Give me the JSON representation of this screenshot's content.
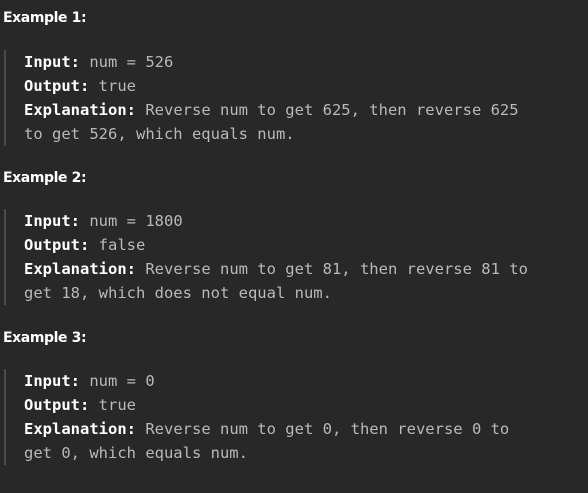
{
  "examples": [
    {
      "heading": "Example 1:",
      "input_label": "Input:",
      "input_value": "num = 526",
      "output_label": "Output:",
      "output_value": "true",
      "explanation_label": "Explanation:",
      "explanation_line1": "Reverse num to get 625, then reverse 625",
      "explanation_line2": "to get 526, which equals num."
    },
    {
      "heading": "Example 2:",
      "input_label": "Input:",
      "input_value": "num = 1800",
      "output_label": "Output:",
      "output_value": "false",
      "explanation_label": "Explanation:",
      "explanation_line1": "Reverse num to get 81, then reverse 81 to",
      "explanation_line2": "get 18, which does not equal num."
    },
    {
      "heading": "Example 3:",
      "input_label": "Input:",
      "input_value": "num = 0",
      "output_label": "Output:",
      "output_value": "true",
      "explanation_label": "Explanation:",
      "explanation_line1": "Reverse num to get 0, then reverse 0 to",
      "explanation_line2": "get 0, which equals num."
    }
  ]
}
